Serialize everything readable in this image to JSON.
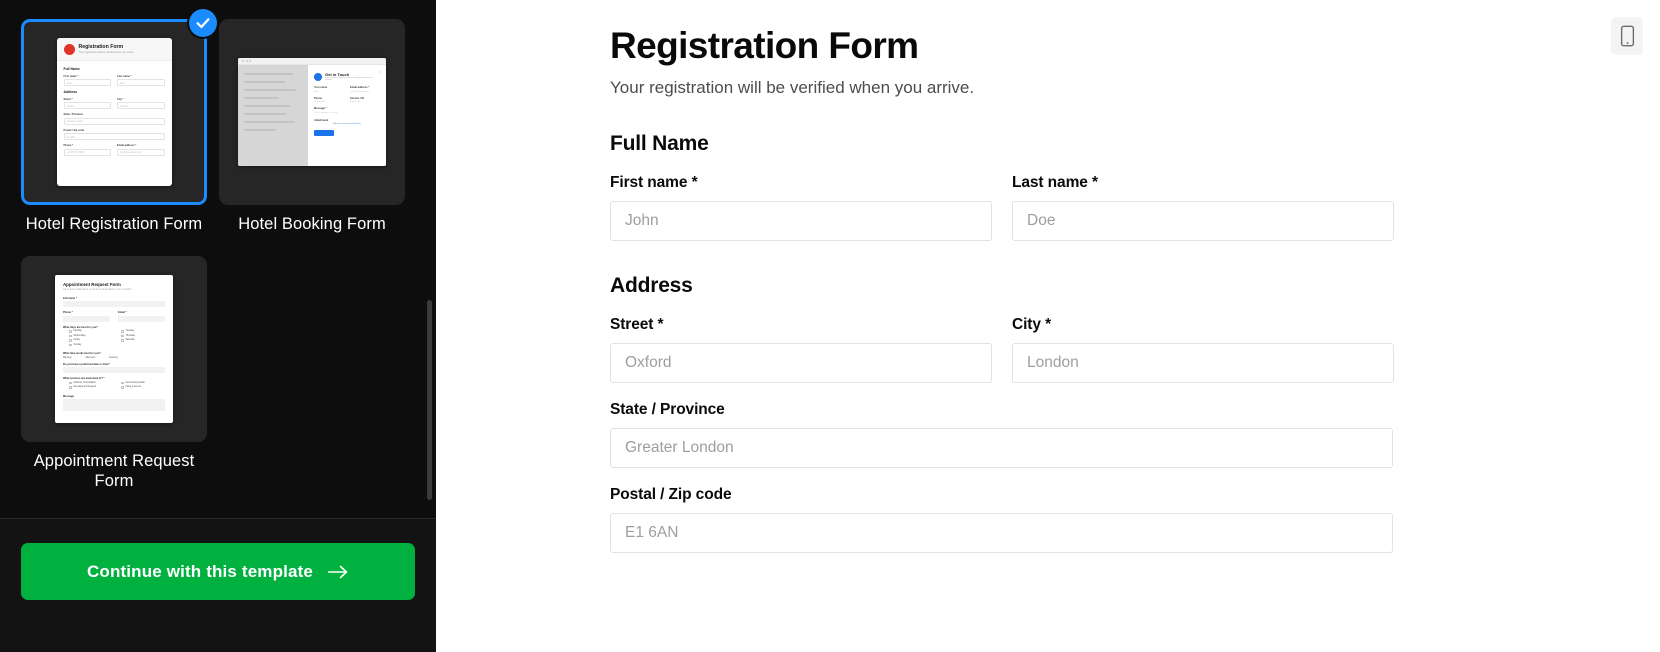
{
  "sidebar": {
    "templates": [
      {
        "label": "Hotel Registration Form",
        "selected": true,
        "preview": {
          "kind": "registration-form",
          "title": "Registration Form",
          "subtitle": "Your registration will be verified when you arrive.",
          "sections": [
            "Full Name",
            "Address"
          ],
          "labels": [
            "First name *",
            "Last name *",
            "Street *",
            "City *",
            "State / Province",
            "Postal / Zip code",
            "Phone *",
            "Email address *"
          ],
          "placeholders": [
            "John",
            "Doe",
            "Oxford",
            "London",
            "Greater London",
            "E1 6AN",
            "+1 234 567 8900",
            "john@example.com"
          ]
        }
      },
      {
        "label": "Hotel Booking Form",
        "selected": false,
        "preview": {
          "kind": "booking-form",
          "title": "Get in Touch",
          "subtitle": "Let us know a little bit and we will get back to you shortly.",
          "labels": [
            "Your name",
            "Email address *",
            "Phone",
            "Service / ID",
            "Message *",
            "Attachment"
          ],
          "link": "Upload or drag and drop files",
          "button": "Submit"
        }
      },
      {
        "label": "Appointment Request Form",
        "selected": false,
        "preview": {
          "kind": "appointment-form",
          "title": "Appointment Request Form",
          "subtitle": "Let us know a little about you and we will get back to you to confirm.",
          "labels": [
            "Full name *",
            "Phone *",
            "Email *",
            "What days are best for you?",
            "What time works best for you?",
            "Do you have a preferred date or time?",
            "What services are interested in? *",
            "Message"
          ],
          "day_options": [
            "Monday",
            "Wednesday",
            "Friday",
            "Sunday",
            "Tuesday",
            "Thursday",
            "Saturday"
          ],
          "time_options": [
            "Morning",
            "Afternoon",
            "Evening"
          ],
          "service_options": [
            "Advisory Consultation",
            "Development Request",
            "Accounting Update",
            "Filing a Service"
          ]
        }
      }
    ],
    "footer": {
      "continue_label": "Continue with this template",
      "continue_icon": "arrow-right-icon",
      "accent_color": "#00b140"
    },
    "selected_badge_icon": "check-icon",
    "selection_color": "#1a8cff",
    "background_color": "#0d0d0d"
  },
  "canvas": {
    "device_toggle": {
      "icon": "mobile-phone-icon",
      "label": "Mobile preview"
    },
    "form": {
      "title": "Registration Form",
      "subtitle": "Your registration will be verified when you arrive.",
      "sections": [
        {
          "heading": "Full Name",
          "rows": [
            [
              {
                "label": "First name *",
                "placeholder": "John",
                "value": "",
                "name": "first-name"
              },
              {
                "label": "Last name *",
                "placeholder": "Doe",
                "value": "",
                "name": "last-name"
              }
            ]
          ]
        },
        {
          "heading": "Address",
          "rows": [
            [
              {
                "label": "Street *",
                "placeholder": "Oxford",
                "value": "",
                "name": "street"
              },
              {
                "label": "City *",
                "placeholder": "London",
                "value": "",
                "name": "city"
              }
            ],
            [
              {
                "label": "State / Province",
                "placeholder": "Greater London",
                "value": "",
                "name": "state-province",
                "full": true
              }
            ],
            [
              {
                "label": "Postal / Zip code",
                "placeholder": "E1 6AN",
                "value": "",
                "name": "postal-zip-code",
                "full": true
              }
            ]
          ]
        }
      ]
    }
  }
}
